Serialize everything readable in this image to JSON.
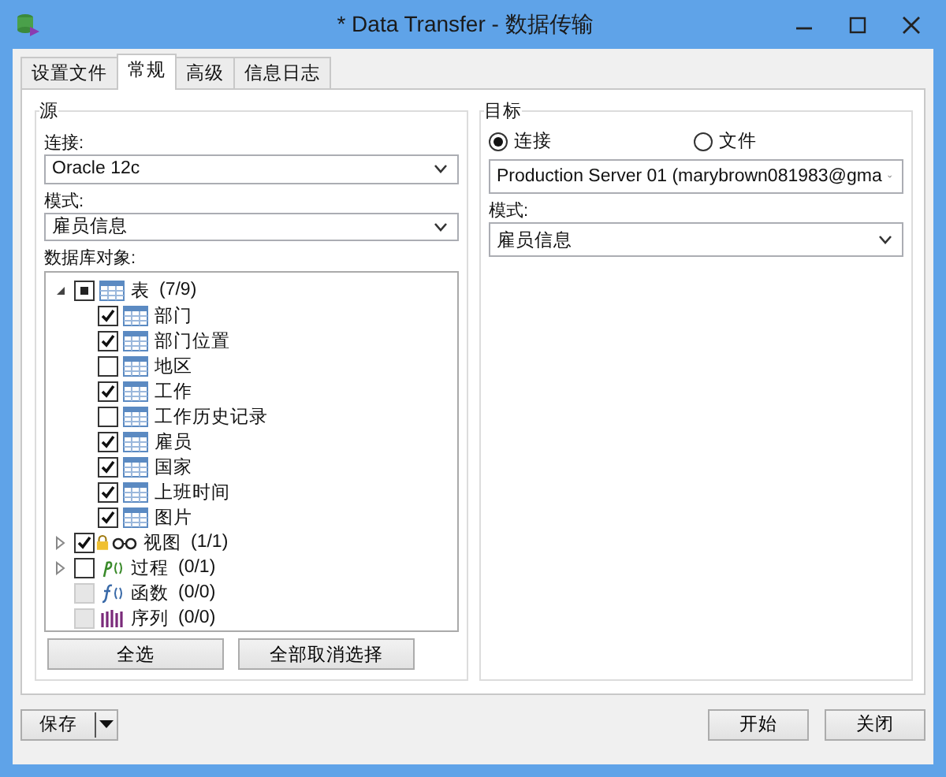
{
  "window": {
    "title": "* Data Transfer - 数据传输"
  },
  "tabs": [
    {
      "label": "设置文件",
      "selected": false
    },
    {
      "label": "常规",
      "selected": true
    },
    {
      "label": "高级",
      "selected": false
    },
    {
      "label": "信息日志",
      "selected": false
    }
  ],
  "source": {
    "title": "源",
    "connection_label": "连接:",
    "connection": "Oracle 12c",
    "schema_label": "模式:",
    "schema": "雇员信息",
    "objects_label": "数据库对象:",
    "tree": [
      {
        "label": "表",
        "count": "(7/9)",
        "kind": "table",
        "expandable": true,
        "expanded": true,
        "checked": false,
        "indeterminate": true,
        "disabled": false,
        "locked": false,
        "children": [
          {
            "label": "部门",
            "kind": "table",
            "checked": true
          },
          {
            "label": "部门位置",
            "kind": "table",
            "checked": true
          },
          {
            "label": "地区",
            "kind": "table",
            "checked": false
          },
          {
            "label": "工作",
            "kind": "table",
            "checked": true
          },
          {
            "label": "工作历史记录",
            "kind": "table",
            "checked": false
          },
          {
            "label": "雇员",
            "kind": "table",
            "checked": true
          },
          {
            "label": "国家",
            "kind": "table",
            "checked": true
          },
          {
            "label": "上班时间",
            "kind": "table",
            "checked": true
          },
          {
            "label": "图片",
            "kind": "table",
            "checked": true
          }
        ]
      },
      {
        "label": "视图",
        "count": "(1/1)",
        "kind": "view",
        "expandable": true,
        "expanded": false,
        "checked": true,
        "indeterminate": false,
        "disabled": false,
        "locked": true
      },
      {
        "label": "过程",
        "count": "(0/1)",
        "kind": "procedure",
        "expandable": true,
        "expanded": false,
        "checked": false,
        "indeterminate": false,
        "disabled": false,
        "locked": false
      },
      {
        "label": "函数",
        "count": "(0/0)",
        "kind": "function",
        "expandable": false,
        "checked": false,
        "indeterminate": false,
        "disabled": true,
        "locked": false
      },
      {
        "label": "序列",
        "count": "(0/0)",
        "kind": "sequence",
        "expandable": false,
        "checked": false,
        "indeterminate": false,
        "disabled": true,
        "locked": false
      }
    ],
    "buttons": [
      "全选",
      "全部取消选择"
    ]
  },
  "target": {
    "title": "目标",
    "options": [
      {
        "label": "连接",
        "selected": true
      },
      {
        "label": "文件",
        "selected": false
      }
    ],
    "connection": "Production Server 01 (marybrown081983@gma",
    "schema_label": "模式:",
    "schema": "雇员信息"
  },
  "footer": {
    "save": "保存",
    "buttons": [
      "开始",
      "关闭"
    ]
  }
}
